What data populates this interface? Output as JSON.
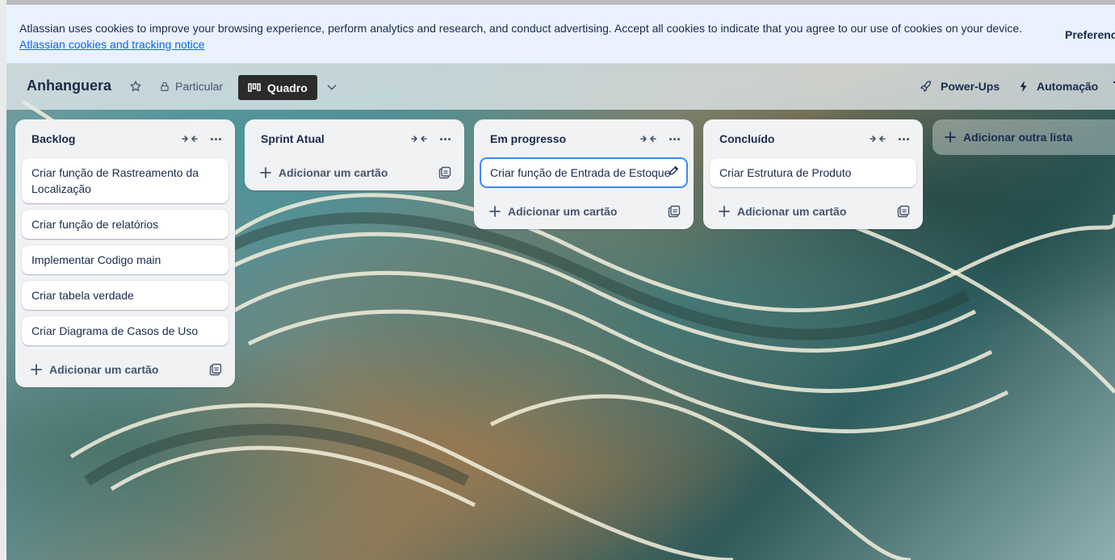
{
  "cookie_banner": {
    "text": "Atlassian uses cookies to improve your browsing experience, perform analytics and research, and conduct advertising. Accept all cookies to indicate that you agree to our use of cookies on your device.",
    "link": "Atlassian cookies and tracking notice",
    "preferences": "Preferences"
  },
  "header": {
    "title": "Anhanguera",
    "visibility": "Particular",
    "view": "Quadro",
    "powerups": "Power-Ups",
    "automation": "Automação"
  },
  "lists": [
    {
      "title": "Backlog",
      "cards": [
        "Criar função de Rastreamento da Localização",
        "Criar função de relatórios",
        "Implementar Codigo main",
        "Criar tabela verdade",
        "Criar Diagrama de Casos de Uso"
      ],
      "add_card": "Adicionar um cartão"
    },
    {
      "title": "Sprint Atual",
      "cards": [],
      "add_card": "Adicionar um cartão"
    },
    {
      "title": "Em progresso",
      "cards": [
        "Criar função de Entrada de Estoque"
      ],
      "add_card": "Adicionar um cartão"
    },
    {
      "title": "Concluído",
      "cards": [
        "Criar Estrutura de Produto"
      ],
      "add_card": "Adicionar um cartão"
    }
  ],
  "add_list": "Adicionar outra lista",
  "colors": {
    "accent": "#0c66e4",
    "focus": "#388bff",
    "list_bg": "#f1f2f4",
    "view_button": "#2b2b2b"
  }
}
